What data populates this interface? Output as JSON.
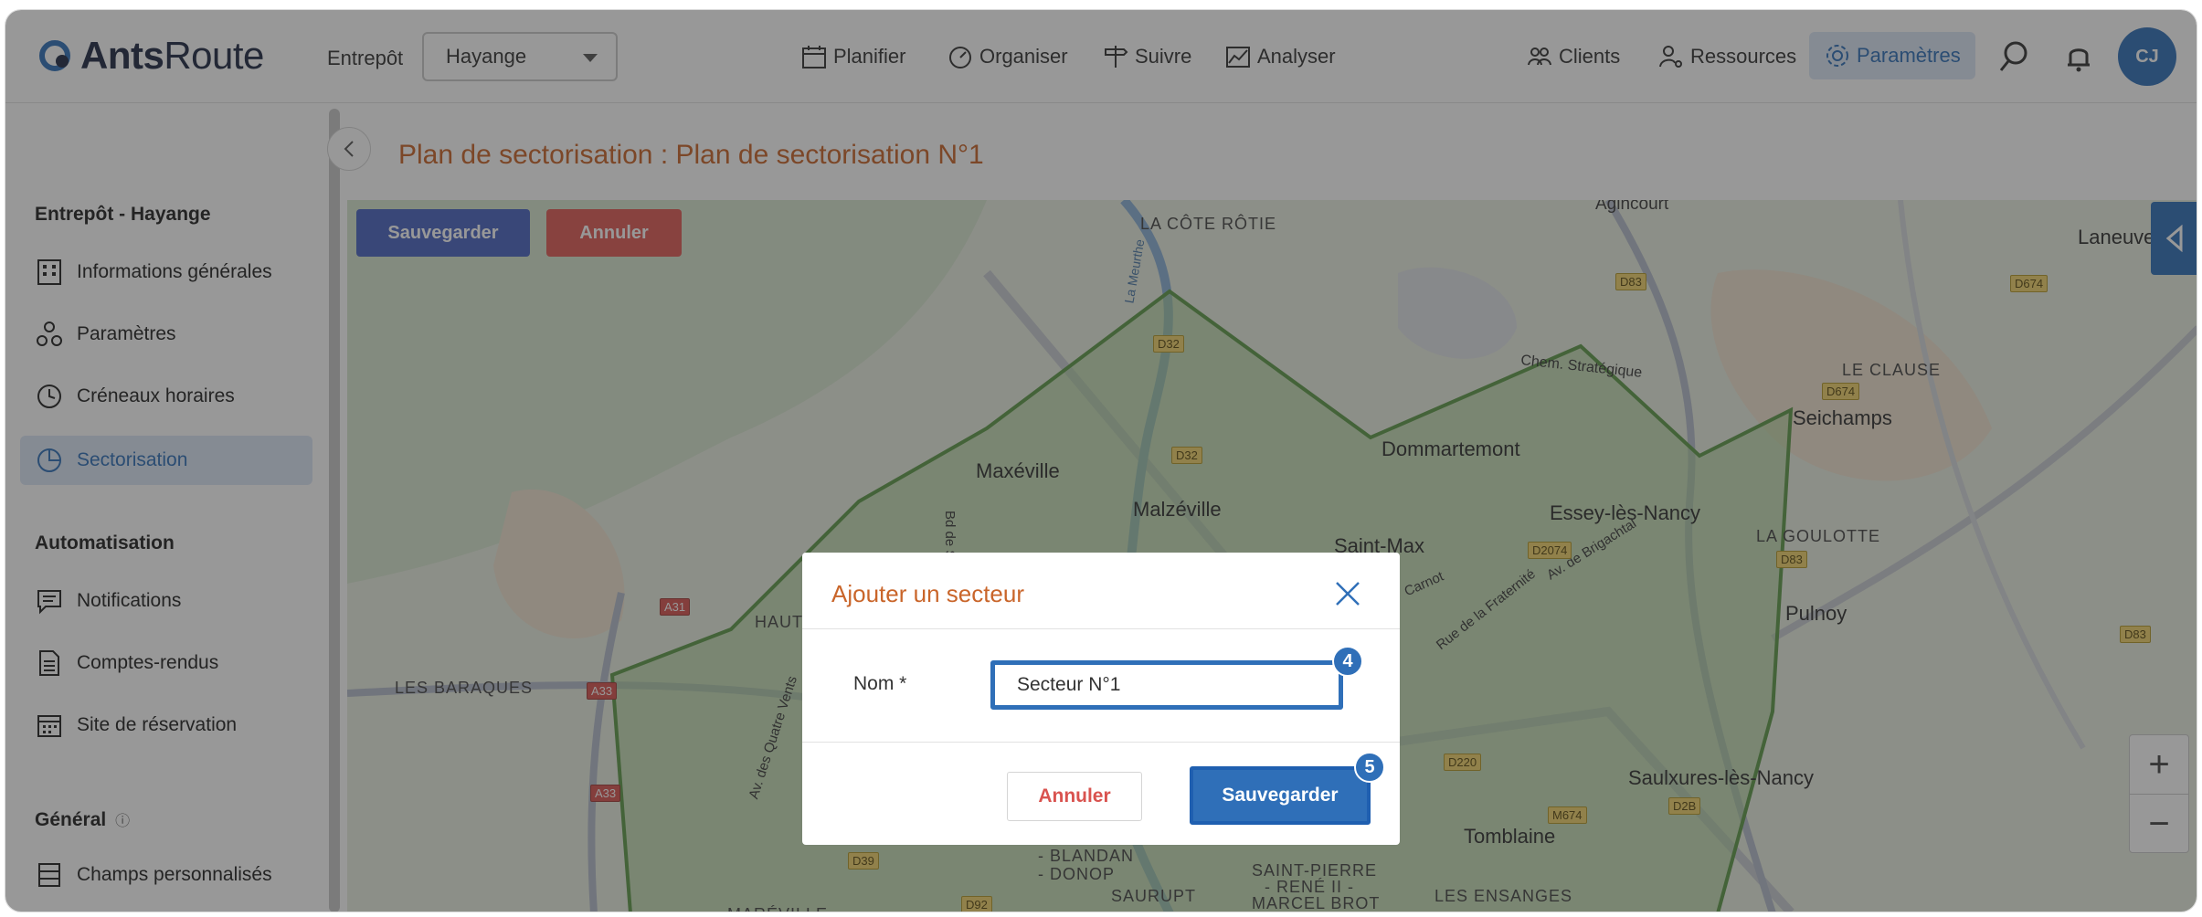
{
  "app": {
    "logo_bold": "Ants",
    "logo_light": "Route",
    "warehouse_label": "Entrepôt",
    "warehouse_value": "Hayange",
    "nav": {
      "plan": "Planifier",
      "organize": "Organiser",
      "track": "Suivre",
      "analyze": "Analyser",
      "clients": "Clients",
      "resources": "Ressources",
      "settings": "Paramètres"
    },
    "avatar_initials": "CJ",
    "accent_color": "#2f6fb8",
    "title_color": "#c9652a"
  },
  "sidebar": {
    "section_warehouse": "Entrepôt - Hayange",
    "items_warehouse": [
      {
        "label": "Informations générales",
        "icon": "building-icon"
      },
      {
        "label": "Paramètres",
        "icon": "nodes-icon"
      },
      {
        "label": "Créneaux horaires",
        "icon": "clock-icon"
      },
      {
        "label": "Sectorisation",
        "icon": "pie-icon",
        "active": true
      }
    ],
    "section_automation": "Automatisation",
    "items_automation": [
      {
        "label": "Notifications",
        "icon": "message-icon"
      },
      {
        "label": "Comptes-rendus",
        "icon": "document-icon"
      },
      {
        "label": "Site de réservation",
        "icon": "calendar-icon"
      }
    ],
    "section_general": "Général",
    "items_general": [
      {
        "label": "Champs personnalisés",
        "icon": "list-icon"
      }
    ]
  },
  "main": {
    "page_title": "Plan de sectorisation : Plan de sectorisation N°1",
    "map_save": "Sauvegarder",
    "map_cancel": "Annuler"
  },
  "map_labels": {
    "cote_rotie": "LA CÔTE RÔTIE",
    "agincourt": "Agincourt",
    "laneuve": "Laneuve",
    "le_clause": "LE CLAUSE",
    "seichamps": "Seichamps",
    "chem": "Chem. Stratégique",
    "dommartemont": "Dommartemont",
    "maxeville": "Maxéville",
    "malzeville": "Malzéville",
    "essey": "Essey-lès-Nancy",
    "saint_max": "Saint-Max",
    "la_goulotte": "LA GOULOTTE",
    "pulnoy": "Pulnoy",
    "les_baraques": "LES BARAQUES",
    "haut": "HAUT",
    "saulxures": "Saulxures-lès-Nancy",
    "tomblaine": "Tomblaine",
    "blandan": "- BLANDAN",
    "donop": "- DONOP",
    "saurupt": "SAURUPT",
    "saint_pierre": "SAINT-PIERRE",
    "rene_ii": "- RENÉ II -",
    "marcel_brot": "MARCEL BROT",
    "les_ensanges": "LES ENSANGES",
    "mareville": "MARÉVILLE",
    "bd_de_sc": "Bd de Sc",
    "av_quatre_vents": "Av. des Quatre Vents",
    "rue_fraternite": "Rue de la Fraternité",
    "av_brigachtal": "Av. de Brigachtal",
    "carnot": "Carnot",
    "la_meurthe": "La Meurthe",
    "roads": [
      "D83",
      "D674",
      "D674",
      "D32",
      "D32",
      "D2074",
      "D83",
      "D83",
      "A31",
      "A33",
      "A33",
      "D220",
      "M674",
      "D2B",
      "D39",
      "D92"
    ]
  },
  "modal": {
    "title": "Ajouter un secteur",
    "field_label": "Nom *",
    "field_value": "Secteur N°1",
    "cancel": "Annuler",
    "save": "Sauvegarder",
    "step_input": "4",
    "step_save": "5"
  }
}
